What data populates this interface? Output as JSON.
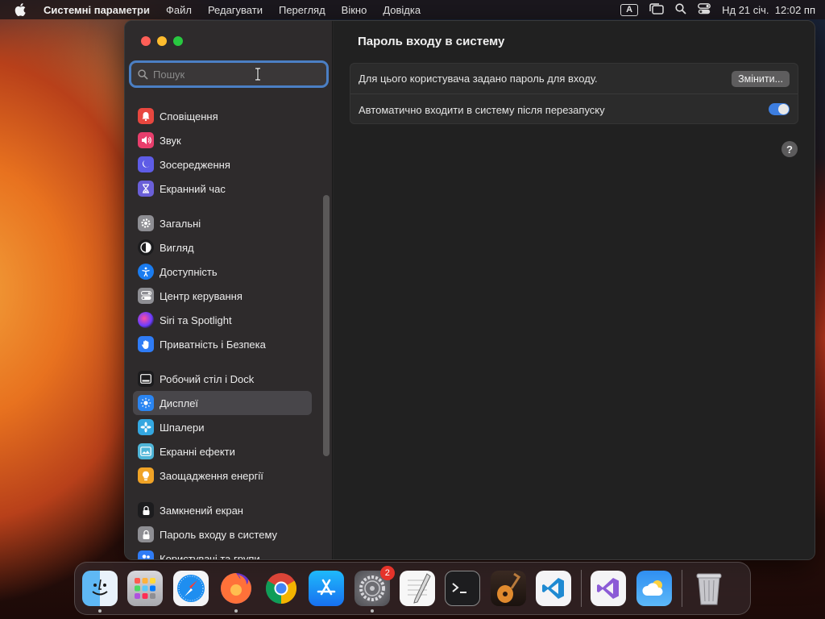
{
  "menubar": {
    "app_name": "Системні параметри",
    "items": [
      "Файл",
      "Редагувати",
      "Перегляд",
      "Вікно",
      "Довідка"
    ],
    "input_source": "A",
    "datetime": "Нд 21 січ.  12:02 пп"
  },
  "search": {
    "placeholder": "Пошук",
    "value": ""
  },
  "sidebar": {
    "groups": [
      [
        {
          "label": "Сповіщення",
          "icon": "bell-icon",
          "color": "#e8473f"
        },
        {
          "label": "Звук",
          "icon": "speaker-icon",
          "color": "#e83e6c"
        },
        {
          "label": "Зосередження",
          "icon": "moon-icon",
          "color": "#5e5ce6"
        },
        {
          "label": "Екранний час",
          "icon": "hourglass-icon",
          "color": "#6a5fd8"
        }
      ],
      [
        {
          "label": "Загальні",
          "icon": "gear-icon",
          "color": "#8e8e93"
        },
        {
          "label": "Вигляд",
          "icon": "appearance-icon",
          "color": "#1c1c1e"
        },
        {
          "label": "Доступність",
          "icon": "accessibility-icon",
          "color": "#1a7cf0"
        },
        {
          "label": "Центр керування",
          "icon": "control-center-icon",
          "color": "#8e8e93"
        },
        {
          "label": "Siri та Spotlight",
          "icon": "siri-icon",
          "color": "#8a3cc8"
        },
        {
          "label": "Приватність і Безпека",
          "icon": "hand-icon",
          "color": "#2f7cf6"
        }
      ],
      [
        {
          "label": "Робочий стіл і Dock",
          "icon": "dock-icon",
          "color": "#1c1c1e"
        },
        {
          "label": "Дисплеї",
          "icon": "display-icon",
          "color": "#2a85f2",
          "selected": true
        },
        {
          "label": "Шпалери",
          "icon": "wallpaper-icon",
          "color": "#34a7e0"
        },
        {
          "label": "Екранні ефекти",
          "icon": "screensaver-icon",
          "color": "#4fb5d8"
        },
        {
          "label": "Заощадження енергії",
          "icon": "lightbulb-icon",
          "color": "#f0a326"
        }
      ],
      [
        {
          "label": "Замкнений екран",
          "icon": "lock-screen-icon",
          "color": "#1c1c1e"
        },
        {
          "label": "Пароль входу в систему",
          "icon": "lock-icon",
          "color": "#8e8e93"
        },
        {
          "label": "Користувачі та групи",
          "icon": "users-icon",
          "color": "#2f7cf6"
        }
      ]
    ]
  },
  "content": {
    "title": "Пароль входу в систему",
    "row1_text": "Для цього користувача задано пароль для входу.",
    "change_button": "Змінити...",
    "row2_text": "Автоматично входити в систему після перезапуску",
    "auto_login_enabled": true,
    "help_label": "?"
  },
  "dock": {
    "apps": [
      {
        "name": "Finder",
        "icon": "finder-icon",
        "running": true
      },
      {
        "name": "Launchpad",
        "icon": "launchpad-icon"
      },
      {
        "name": "Safari",
        "icon": "safari-icon"
      },
      {
        "name": "Firefox",
        "icon": "firefox-icon",
        "running": true
      },
      {
        "name": "Chrome",
        "icon": "chrome-icon"
      },
      {
        "name": "App Store",
        "icon": "appstore-icon"
      },
      {
        "name": "System Settings",
        "icon": "settings-icon",
        "running": true,
        "badge": "2"
      },
      {
        "name": "TextEdit",
        "icon": "textedit-icon"
      },
      {
        "name": "Terminal",
        "icon": "terminal-icon"
      },
      {
        "name": "GarageBand",
        "icon": "garageband-icon"
      },
      {
        "name": "VS Code",
        "icon": "vscode-icon"
      },
      {
        "name": "Visual Studio",
        "icon": "visualstudio-icon"
      },
      {
        "name": "Weather",
        "icon": "weather-icon"
      },
      {
        "name": "Trash",
        "icon": "trash-icon"
      }
    ]
  }
}
